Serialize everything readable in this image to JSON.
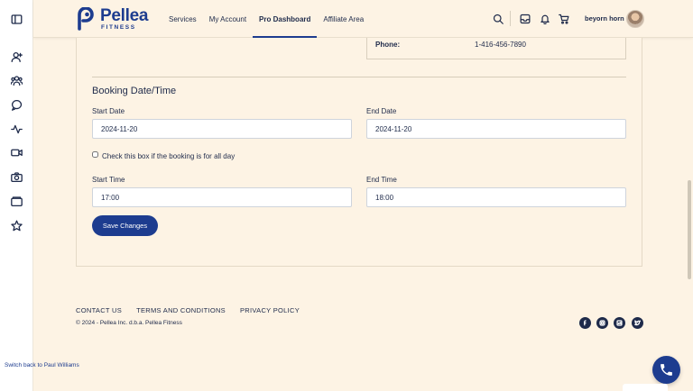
{
  "brand": {
    "name": "Pellea",
    "sub": "FITNESS",
    "color": "#1d3c8f"
  },
  "nav": [
    {
      "label": "Services"
    },
    {
      "label": "My Account"
    },
    {
      "label": "Pro Dashboard",
      "active": true
    },
    {
      "label": "Affiliate Area"
    }
  ],
  "user": {
    "name": "beyorn horn"
  },
  "contact": {
    "phone_label": "Phone:",
    "phone_value": "1-416-456-7890"
  },
  "booking": {
    "title": "Booking Date/Time",
    "start_date_label": "Start Date",
    "start_date_value": "2024-11-20",
    "end_date_label": "End Date",
    "end_date_value": "2024-11-20",
    "all_day_label": "Check this box if the booking is for all day",
    "all_day_checked": false,
    "start_time_label": "Start Time",
    "start_time_value": "17:00",
    "end_time_label": "End Time",
    "end_time_value": "18:00",
    "save_label": "Save Changes"
  },
  "footer": {
    "links": [
      "CONTACT US",
      "TERMS AND CONDITIONS",
      "PRIVACY POLICY"
    ],
    "copyright": "© 2024 - Pellea Inc. d.b.a. Pellea Fitness",
    "social": [
      "facebook-icon",
      "instagram-icon",
      "linkedin-icon",
      "twitter-icon"
    ]
  },
  "switch_back": "Switch back to Paul Williams",
  "sidebar_icons": [
    "sidebar-toggle-icon",
    "user-icon",
    "group-icon",
    "chat-icon",
    "activity-icon",
    "video-icon",
    "camera-icon",
    "folder-icon",
    "star-icon"
  ]
}
